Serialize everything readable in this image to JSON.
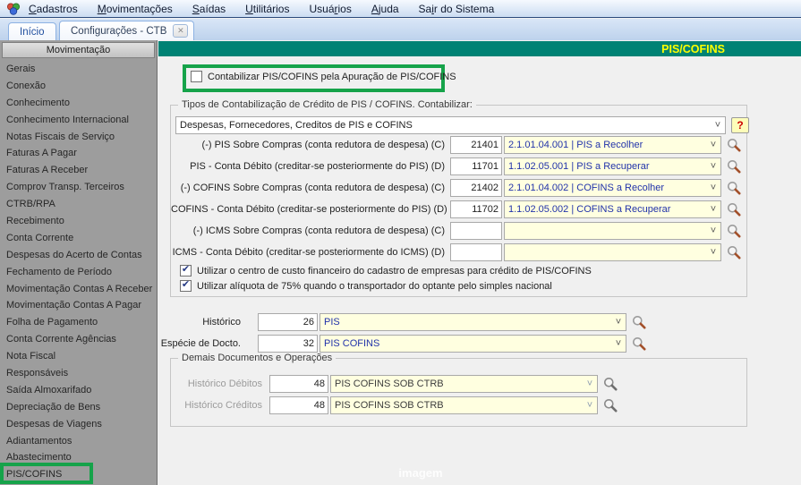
{
  "icons": {
    "check": "✔",
    "close": "✕",
    "chevron": "˅",
    "help": "?"
  },
  "colors": {
    "teal_bar": "#008274",
    "title_yellow": "#FFFF00",
    "annotation_green": "#16A34A",
    "combo_yellow": "#FFFFE0",
    "account_blue": "#2233AA"
  },
  "menu": {
    "items": [
      {
        "label": "Cadastros",
        "accel": 0
      },
      {
        "label": "Movimentações",
        "accel": 0
      },
      {
        "label": "Saídas",
        "accel": 0
      },
      {
        "label": "Utilitários",
        "accel": 0
      },
      {
        "label": "Usuários",
        "accel": 4
      },
      {
        "label": "Ajuda",
        "accel": 0
      },
      {
        "label": "Sair do Sistema",
        "accel": 2
      }
    ]
  },
  "tabs": [
    {
      "label": "Início"
    },
    {
      "label": "Configurações - CTB"
    }
  ],
  "sidebar": {
    "title": "Movimentação",
    "items": [
      "Gerais",
      "Conexão",
      "Conhecimento",
      "Conhecimento Internacional",
      "Notas Fiscais de Serviço",
      "Faturas A Pagar",
      "Faturas A Receber",
      "Comprov Transp. Terceiros",
      "CTRB/RPA",
      "Recebimento",
      "Conta Corrente",
      "Despesas do Acerto de Contas",
      "Fechamento de Período",
      "Movimentação Contas A Receber",
      "Movimentação Contas A Pagar",
      "Folha de Pagamento",
      "Conta Corrente Agências",
      "Nota Fiscal",
      "Responsáveis",
      "Saída Almoxarifado",
      "Depreciação de Bens",
      "Despesas de Viagens",
      "Adiantamentos",
      "Abastecimento",
      "PIS/COFINS"
    ],
    "highlighted_item": "PIS/COFINS"
  },
  "main": {
    "title": "PIS/COFINS",
    "apuracao_checkbox": {
      "label": "Contabilizar PIS/COFINS pela Apuração de PIS/COFINS",
      "checked": false
    },
    "tipos_group": {
      "title": "Tipos de Contabilização de Crédito de PIS / COFINS. Contabilizar:",
      "tipo_select_value": "Despesas, Fornecedores, Creditos de PIS e COFINS",
      "rows": [
        {
          "label": "(-) PIS Sobre Compras (conta redutora de despesa) (C)",
          "code": "21401",
          "account": "2.1.01.04.001 | PIS a Recolher"
        },
        {
          "label": "PIS - Conta Débito (creditar-se posteriormente do PIS) (D)",
          "code": "11701",
          "account": "1.1.02.05.001 | PIS a Recuperar"
        },
        {
          "label": "(-) COFINS Sobre Compras (conta redutora de despesa) (C)",
          "code": "21402",
          "account": "2.1.01.04.002 | COFINS a Recolher"
        },
        {
          "label": "COFINS - Conta Débito (creditar-se posteriormente do PIS) (D)",
          "code": "11702",
          "account": "1.1.02.05.002 | COFINS a Recuperar"
        },
        {
          "label": "(-) ICMS Sobre Compras (conta redutora de despesa) (C)",
          "code": "",
          "account": ""
        },
        {
          "label": "ICMS - Conta Débito (creditar-se posteriormente do ICMS) (D)",
          "code": "",
          "account": ""
        }
      ],
      "checkboxes": [
        {
          "label": "Utilizar o centro de custo financeiro do cadastro de empresas para crédito de PIS/COFINS",
          "checked": true
        },
        {
          "label": "Utilizar alíquota de 75% quando o transportador do optante pelo simples nacional",
          "checked": true
        }
      ]
    },
    "historico": {
      "label": "Histórico",
      "code": "26",
      "value": "PIS"
    },
    "especie": {
      "label": "Espécie de Docto.",
      "code": "32",
      "value": "PIS COFINS"
    },
    "demais_group": {
      "title": "Demais Documentos e Operações",
      "rows": [
        {
          "label": "Histórico Débitos",
          "code": "48",
          "value": "PIS COFINS SOB CTRB"
        },
        {
          "label": "Histórico Créditos",
          "code": "48",
          "value": "PIS COFINS SOB CTRB"
        }
      ]
    },
    "watermark": "imagem"
  }
}
